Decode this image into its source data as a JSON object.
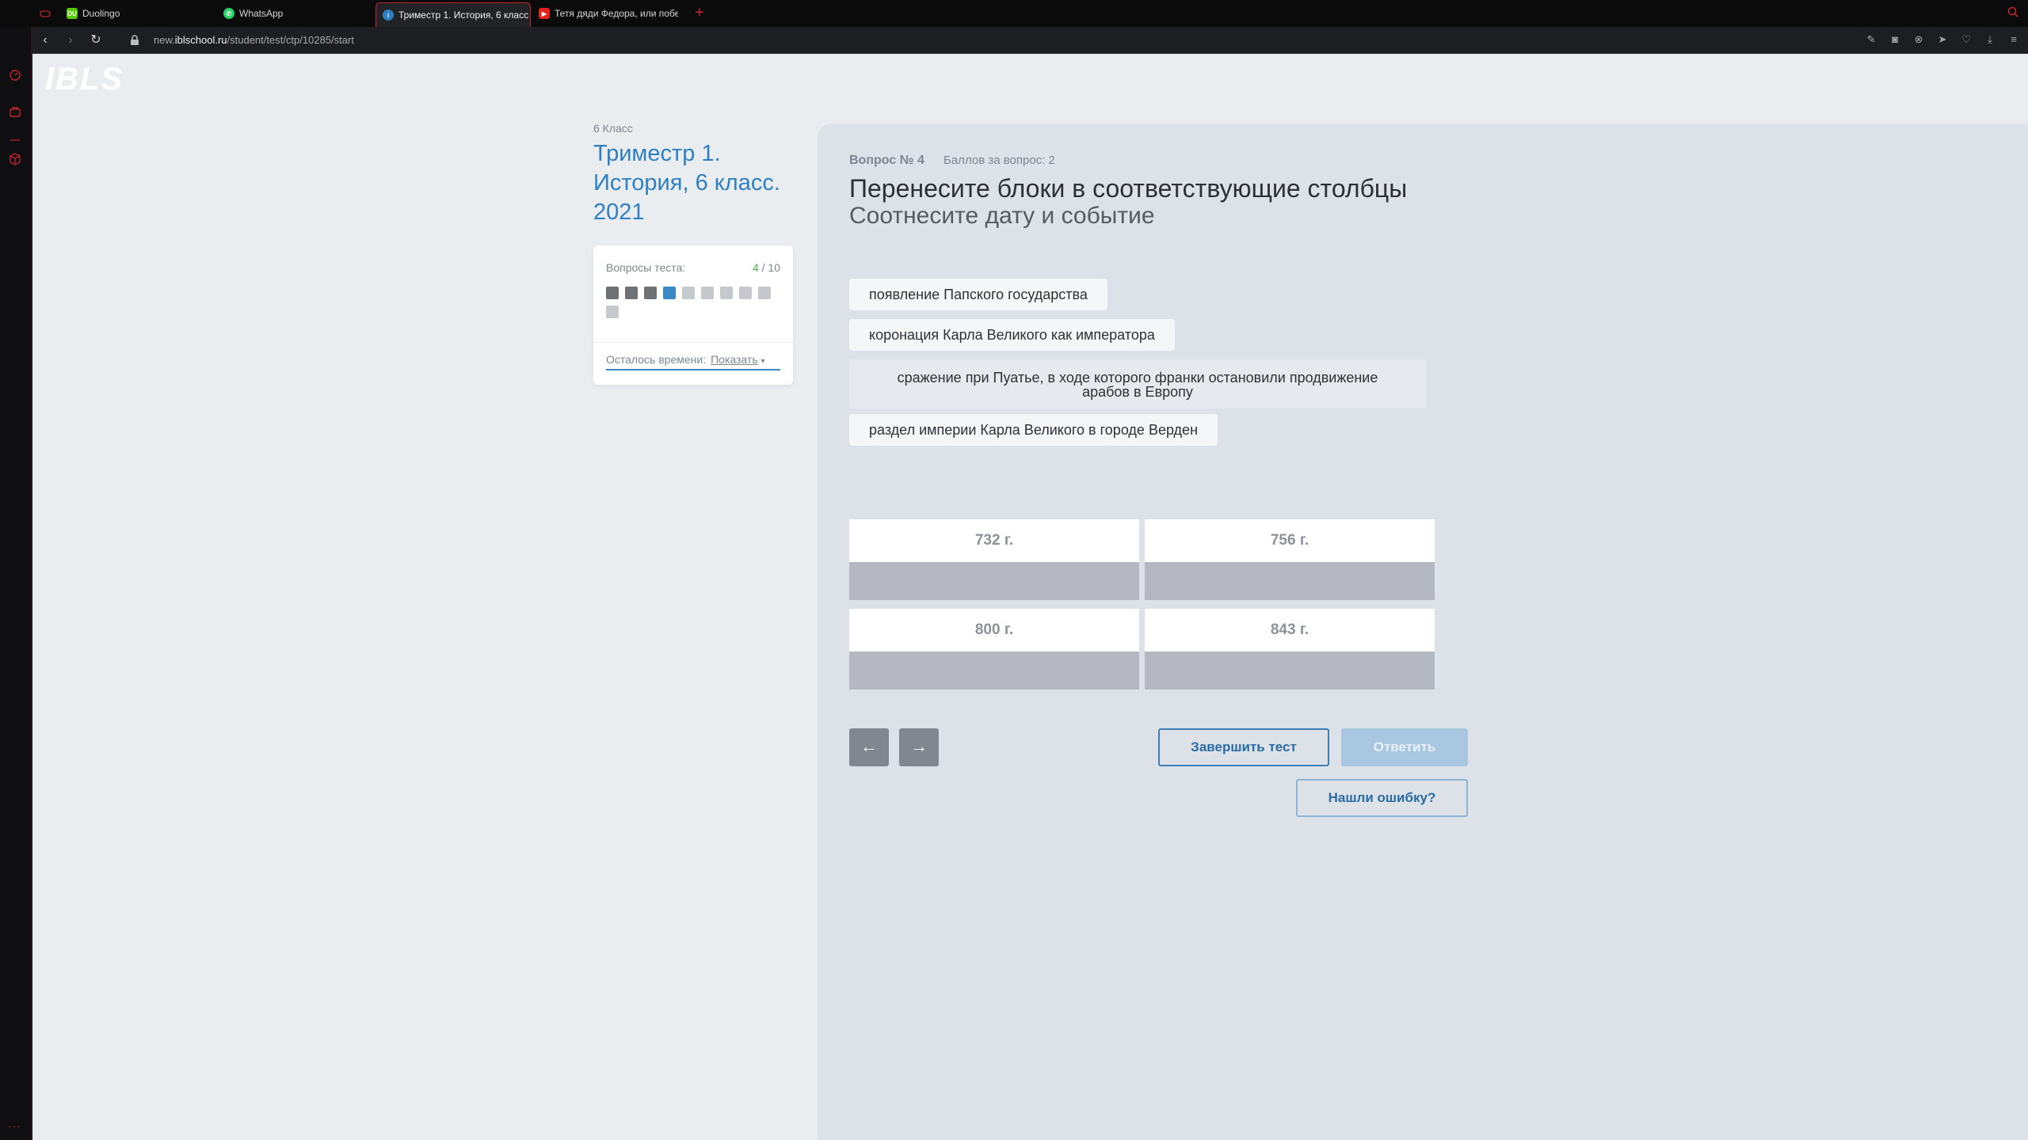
{
  "browser": {
    "tabs": [
      {
        "label": "",
        "icon": "game-icon"
      },
      {
        "label": "Duolingo",
        "icon": "duolingo-icon"
      },
      {
        "label": "WhatsApp",
        "icon": "whatsapp-icon"
      },
      {
        "label": "Триместр 1. История, 6 класс",
        "icon": "ibls-icon"
      },
      {
        "label": "Тетя дяди Федора, или побег",
        "icon": "youtube-icon"
      }
    ],
    "new_tab": "+",
    "url_prefix": "new.",
    "url_domain": "iblschool.ru",
    "url_path": "/student/test/ctp/10285/start"
  },
  "app": {
    "logo": "IBLS"
  },
  "test": {
    "grade": "6 Класс",
    "title": "Триместр 1. История, 6 класс. 2021",
    "questions_label": "Вопросы теста:",
    "current": "4",
    "total": "/ 10",
    "time_label": "Осталось времени:",
    "show_label": "Показать",
    "question_states": [
      "done",
      "done",
      "done",
      "current",
      "todo",
      "todo",
      "todo",
      "todo",
      "todo",
      "todo"
    ]
  },
  "question": {
    "number": "Вопрос № 4",
    "points": "Баллов за вопрос: 2",
    "title": "Перенесите блоки в соответствующие столбцы",
    "subtitle": "Соотнесите дату и событие",
    "blocks": [
      "появление Папского государства",
      "коронация Карла Великого как императора",
      "сражение при Пуатье, в ходе которого франки остановили продвижение арабов в Европу",
      "раздел империи Карла Великого в городе Верден"
    ],
    "columns": [
      "732 г.",
      "756 г.",
      "800 г.",
      "843 г."
    ]
  },
  "actions": {
    "prev": "←",
    "next": "→",
    "finish": "Завершить тест",
    "answer": "Ответить",
    "report": "Нашли ошибку?"
  },
  "colors": {
    "accent": "#2f7fc1",
    "current_question": "#3b88c9",
    "answered_progress": "#4caf50",
    "browser_accent": "#c0262d"
  }
}
